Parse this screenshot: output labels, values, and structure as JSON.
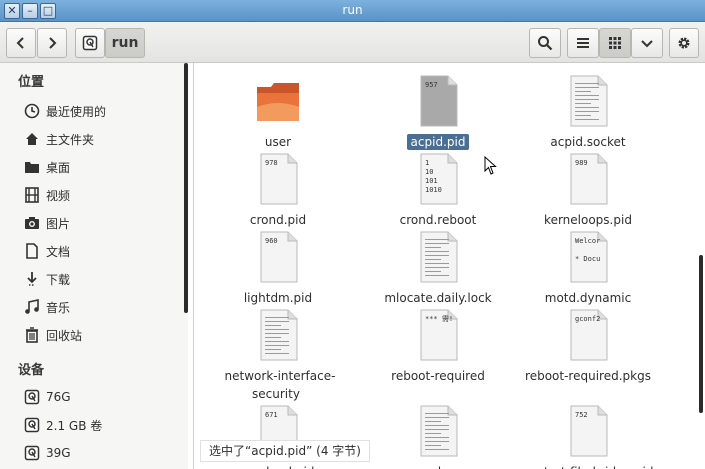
{
  "window": {
    "title": "run"
  },
  "toolbar": {
    "back_icon": "chevron-left-icon",
    "forward_icon": "chevron-right-icon",
    "location": "run",
    "search_icon": "search-icon",
    "list_view_icon": "list-view-icon",
    "grid_view_icon": "grid-view-icon",
    "view_options_icon": "chevron-down-icon",
    "settings_icon": "gear-icon"
  },
  "sidebar": {
    "places_heading": "位置",
    "places": [
      {
        "label": "最近使用的",
        "icon": "clock-icon"
      },
      {
        "label": "主文件夹",
        "icon": "home-icon"
      },
      {
        "label": "桌面",
        "icon": "desktop-folder-icon"
      },
      {
        "label": "视频",
        "icon": "video-icon"
      },
      {
        "label": "图片",
        "icon": "camera-icon"
      },
      {
        "label": "文档",
        "icon": "document-icon"
      },
      {
        "label": "下载",
        "icon": "download-icon"
      },
      {
        "label": "音乐",
        "icon": "music-icon"
      },
      {
        "label": "回收站",
        "icon": "trash-icon"
      }
    ],
    "devices_heading": "设备",
    "devices": [
      {
        "label": "76G",
        "icon": "drive-icon"
      },
      {
        "label": "2.1 GB 卷",
        "icon": "drive-icon"
      },
      {
        "label": "39G",
        "icon": "drive-icon"
      }
    ]
  },
  "files": [
    {
      "name": "user",
      "kind": "folder",
      "preview": ""
    },
    {
      "name": "acpid.pid",
      "kind": "text",
      "preview": "957",
      "selected": true
    },
    {
      "name": "acpid.socket",
      "kind": "text",
      "preview": ""
    },
    {
      "name": "crond.pid",
      "kind": "text",
      "preview": "978"
    },
    {
      "name": "crond.reboot",
      "kind": "text",
      "preview": "1\n10\n101\n1010"
    },
    {
      "name": "kerneloops.pid",
      "kind": "text",
      "preview": "989"
    },
    {
      "name": "lightdm.pid",
      "kind": "text",
      "preview": "960"
    },
    {
      "name": "mlocate.daily.lock",
      "kind": "text",
      "preview": ""
    },
    {
      "name": "motd.dynamic",
      "kind": "text",
      "preview": "Welcor\n\n* Docu"
    },
    {
      "name": "network-interface-security",
      "kind": "text",
      "preview": ""
    },
    {
      "name": "reboot-required",
      "kind": "text",
      "preview": "*** 需!"
    },
    {
      "name": "reboot-required.pkgs",
      "kind": "text",
      "preview": "gconf2"
    },
    {
      "name": "rsyslogd.pid",
      "kind": "text",
      "preview": "671"
    },
    {
      "name": "sdp",
      "kind": "text",
      "preview": ""
    },
    {
      "name": "upstart-file-bridge.pid",
      "kind": "text",
      "preview": "752"
    }
  ],
  "status": "选中了“acpid.pid” (4 字节)",
  "colors": {
    "selection": "#4a6f94",
    "titlebar": "#6aa3d6",
    "folder": "#e8743b"
  }
}
